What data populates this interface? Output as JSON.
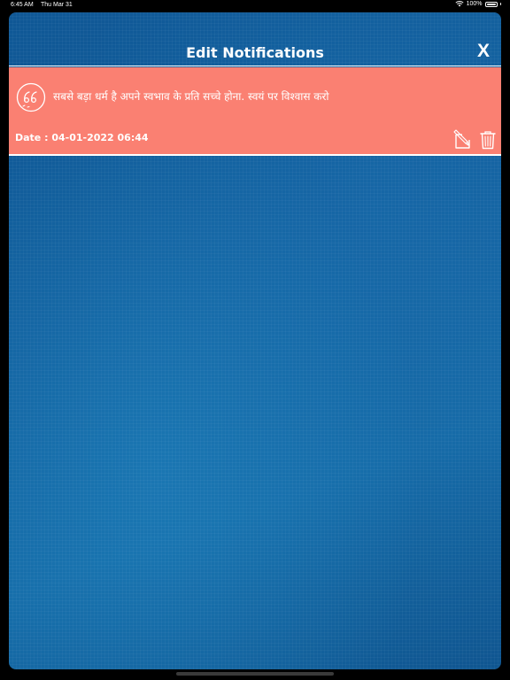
{
  "status_bar": {
    "time": "6:45 AM",
    "date": "Thu Mar 31",
    "battery": "100%"
  },
  "header": {
    "title": "Edit Notifications",
    "close_label": "X"
  },
  "notification": {
    "message": "सबसे बड़ा धर्म है अपने स्वभाव के प्रति सच्चे होना. स्वयं पर विश्वास करो",
    "date_text": "Date : 04-01-2022 06:44",
    "icons": [
      "quote-icon",
      "edit-icon",
      "trash-icon"
    ]
  },
  "colors": {
    "background": "#13609e",
    "notification_bg": "#fa8072",
    "text": "#ffffff"
  }
}
